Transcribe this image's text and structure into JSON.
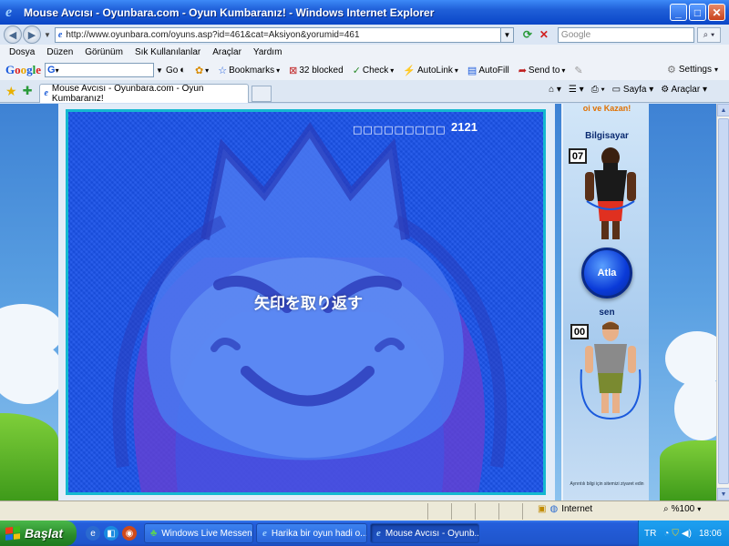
{
  "window": {
    "title": "Mouse Avcısı - Oyunbara.com - Oyun Kumbaranız! - Windows Internet Explorer",
    "buttons": {
      "minimize": "_",
      "maximize": "□",
      "close": "✕"
    }
  },
  "address_bar": {
    "url": "http://www.oyunbara.com/oyuns.asp?id=461&cat=Aksiyon&yorumid=461",
    "search_placeholder": "Google"
  },
  "menu": [
    "Dosya",
    "Düzen",
    "Görünüm",
    "Sık Kullanılanlar",
    "Araçlar",
    "Yardım"
  ],
  "google_toolbar": {
    "go": "Go",
    "bookmarks": "Bookmarks",
    "blocked": "32 blocked",
    "check": "Check",
    "autolink": "AutoLink",
    "autofill": "AutoFill",
    "send_to": "Send to",
    "settings": "Settings"
  },
  "tabs": [
    {
      "label": "Mouse Avcısı - Oyunbara.com - Oyun Kumbaranız!"
    }
  ],
  "command_bar": {
    "page": "Sayfa",
    "tools": "Araçlar"
  },
  "game": {
    "score_boxes": "□□□□□□□□□",
    "score": "2121",
    "message": "矢印を取り返す"
  },
  "side_panel": {
    "top_text": "oi ve Kazan!",
    "computer_label": "Bilgisayar",
    "computer_count": "07",
    "jump_button": "Atla",
    "player_label": "sen",
    "player_count": "00",
    "footer": "Ayrıntılı bilgi için sitemizi ziyaret edin"
  },
  "status_bar": {
    "zone": "Internet",
    "zoom": "%100"
  },
  "taskbar": {
    "start": "Başlat",
    "tasks": [
      {
        "label": "Windows Live Messen..."
      },
      {
        "label": "Harika bir oyun hadi o..."
      },
      {
        "label": "Mouse Avcısı - Oyunb..."
      }
    ],
    "tray_lang": "TR",
    "clock": "18:06"
  },
  "colors": {
    "game_blue": "#1a52e8",
    "game_border": "#15b8d0",
    "xp_blue": "#245edb",
    "start_green": "#2a8a2a"
  }
}
